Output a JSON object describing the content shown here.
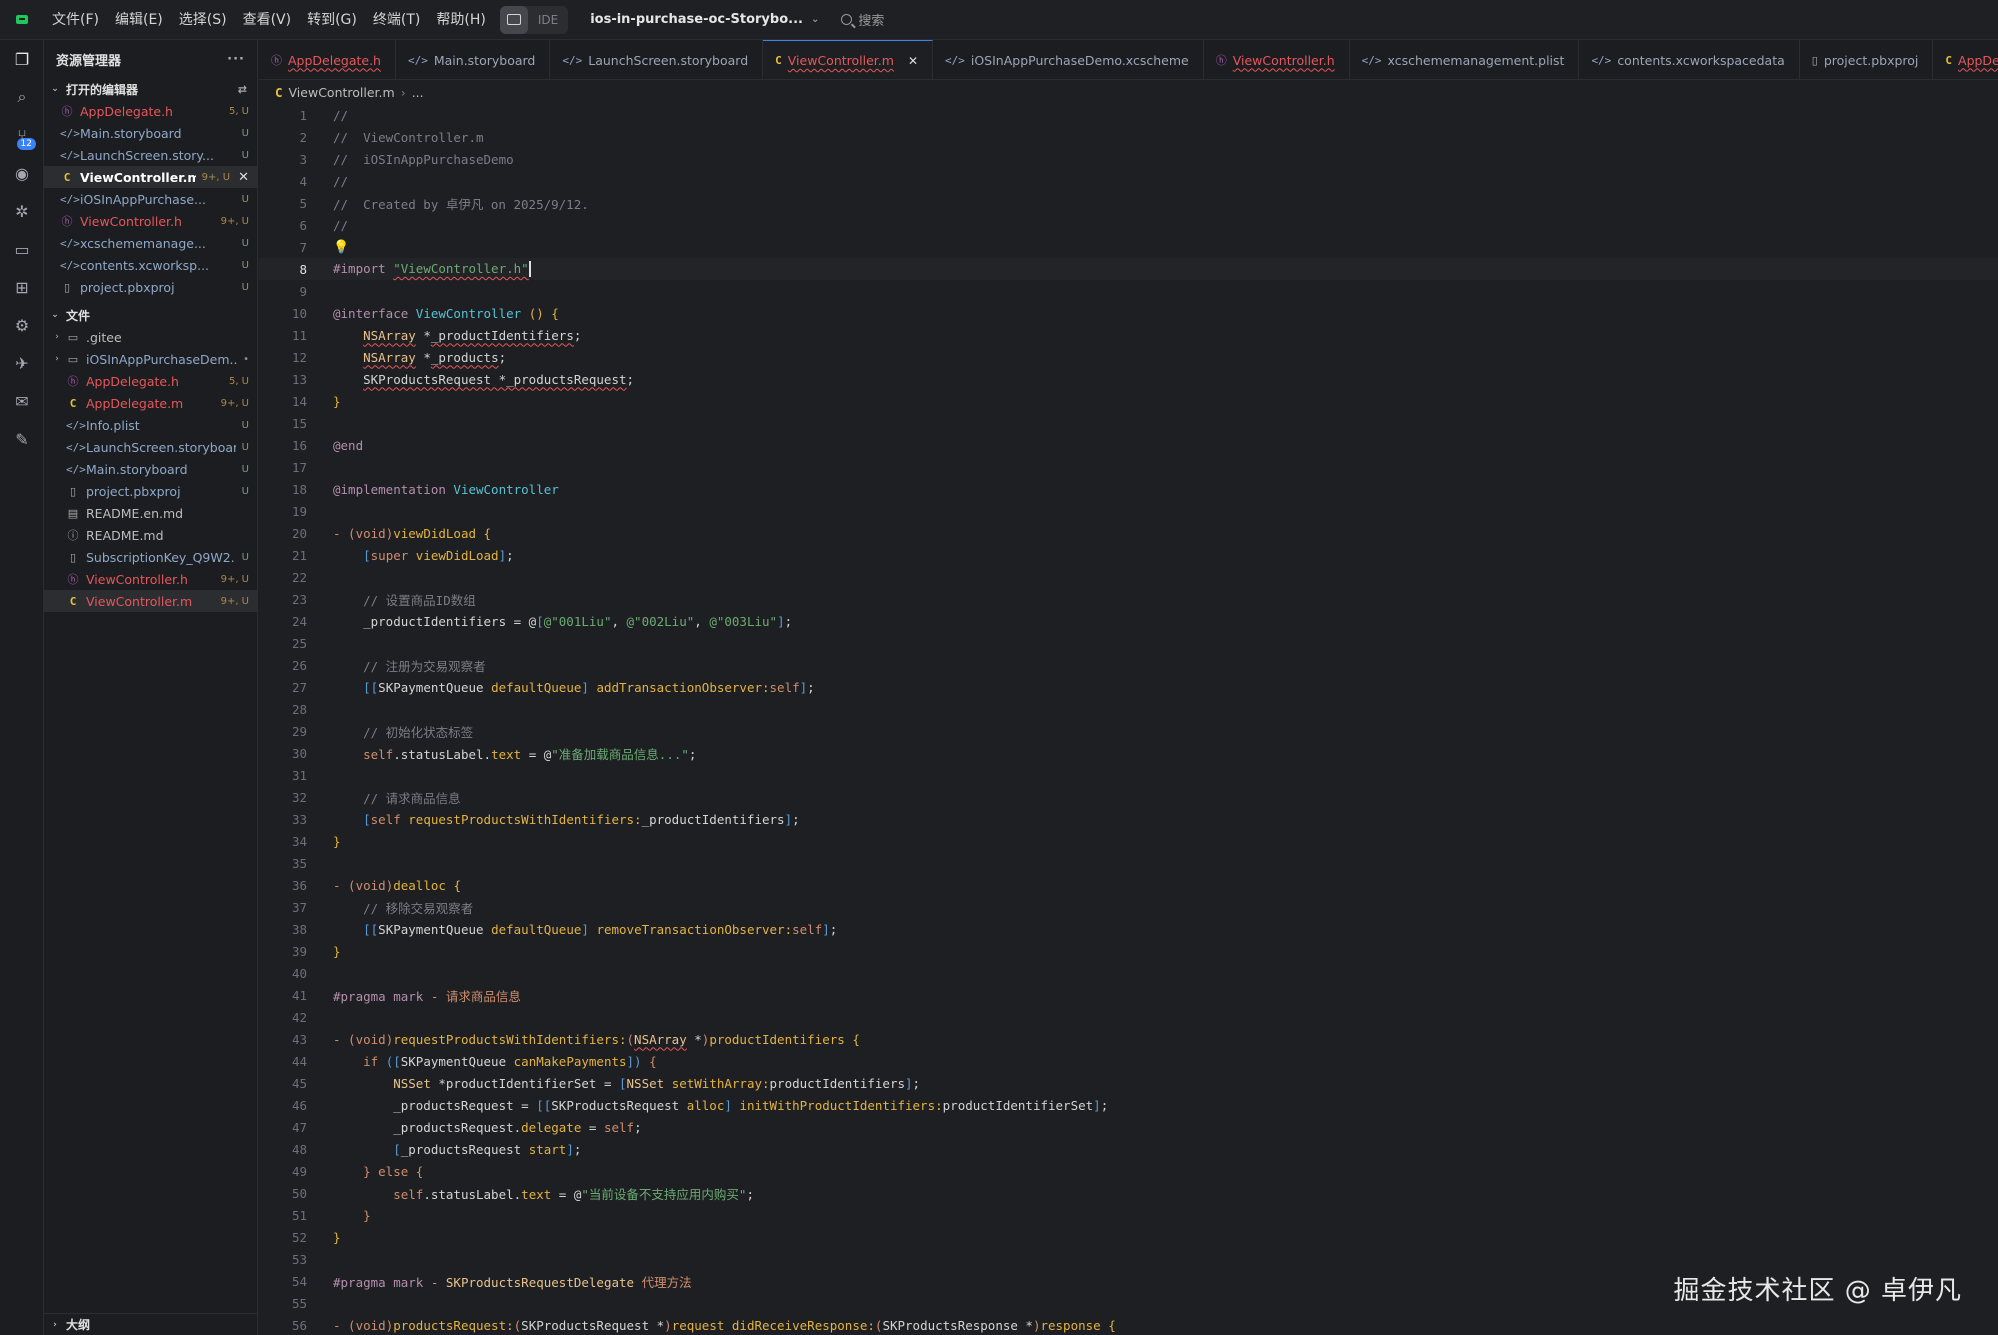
{
  "menu": [
    "文件(F)",
    "编辑(E)",
    "选择(S)",
    "查看(V)",
    "转到(G)",
    "终端(T)",
    "帮助(H)"
  ],
  "ide_label": "IDE",
  "project": "ios-in-purchase-oc-Storybo...",
  "search_label": "搜索",
  "activity_badge": "12",
  "sidebar": {
    "title": "资源管理器",
    "open_editors_label": "打开的编辑器",
    "open_editors": [
      {
        "name": "AppDelegate.h",
        "status": "5, U",
        "icon": "header-icon",
        "style": "err"
      },
      {
        "name": "Main.storyboard",
        "status": "U",
        "icon": "code-icon",
        "style": "mod"
      },
      {
        "name": "LaunchScreen.story...",
        "status": "U",
        "icon": "code-icon",
        "style": "mod"
      },
      {
        "name": "ViewController.m",
        "status": "9+, U",
        "icon": "c-file-icon",
        "style": "bold"
      },
      {
        "name": "iOSInAppPurchase...",
        "status": "U",
        "icon": "code-icon",
        "style": "mod"
      },
      {
        "name": "ViewController.h",
        "status": "9+, U",
        "icon": "header-icon",
        "style": "err"
      },
      {
        "name": "xcschememanage...",
        "status": "U",
        "icon": "code-icon",
        "style": "mod"
      },
      {
        "name": "contents.xcworksp...",
        "status": "U",
        "icon": "code-icon",
        "style": "mod"
      },
      {
        "name": "project.pbxproj",
        "status": "U",
        "icon": "file-icon",
        "style": "mod"
      }
    ],
    "files_label": "文件",
    "files": [
      {
        "name": ".gitee",
        "status": "",
        "icon": "folder-icon",
        "style": "plain",
        "caret": "›"
      },
      {
        "name": "iOSInAppPurchaseDem...",
        "status": "•",
        "icon": "folder-icon",
        "style": "mod",
        "caret": "›"
      },
      {
        "name": "AppDelegate.h",
        "status": "5, U",
        "icon": "header-icon",
        "style": "err",
        "caret": ""
      },
      {
        "name": "AppDelegate.m",
        "status": "9+, U",
        "icon": "c-file-icon",
        "style": "err",
        "caret": ""
      },
      {
        "name": "Info.plist",
        "status": "U",
        "icon": "code-icon",
        "style": "mod",
        "caret": ""
      },
      {
        "name": "LaunchScreen.storyboard",
        "status": "U",
        "icon": "code-icon",
        "style": "mod",
        "caret": ""
      },
      {
        "name": "Main.storyboard",
        "status": "U",
        "icon": "code-icon",
        "style": "mod",
        "caret": ""
      },
      {
        "name": "project.pbxproj",
        "status": "U",
        "icon": "file-icon",
        "style": "mod",
        "caret": ""
      },
      {
        "name": "README.en.md",
        "status": "",
        "icon": "markdown-icon",
        "style": "plain",
        "caret": ""
      },
      {
        "name": "README.md",
        "status": "",
        "icon": "info-icon",
        "style": "plain",
        "caret": ""
      },
      {
        "name": "SubscriptionKey_Q9W2...",
        "status": "U",
        "icon": "file-icon",
        "style": "mod",
        "caret": ""
      },
      {
        "name": "ViewController.h",
        "status": "9+, U",
        "icon": "header-icon",
        "style": "err",
        "caret": ""
      },
      {
        "name": "ViewController.m",
        "status": "9+, U",
        "icon": "c-file-icon",
        "style": "err",
        "caret": ""
      }
    ],
    "outline_label": "大纲"
  },
  "tabs": [
    {
      "name": "AppDelegate.h",
      "icon": "header-icon",
      "style": "err"
    },
    {
      "name": "Main.storyboard",
      "icon": "code-icon",
      "style": "mod"
    },
    {
      "name": "LaunchScreen.storyboard",
      "icon": "code-icon",
      "style": "mod"
    },
    {
      "name": "ViewController.m",
      "icon": "c-file-icon",
      "style": "err",
      "active": true
    },
    {
      "name": "iOSInAppPurchaseDemo.xcscheme",
      "icon": "code-icon",
      "style": "mod"
    },
    {
      "name": "ViewController.h",
      "icon": "header-icon",
      "style": "err"
    },
    {
      "name": "xcschememanagement.plist",
      "icon": "code-icon",
      "style": "mod"
    },
    {
      "name": "contents.xcworkspacedata",
      "icon": "code-icon",
      "style": "mod"
    },
    {
      "name": "project.pbxproj",
      "icon": "file-icon",
      "style": "mod"
    },
    {
      "name": "AppDelegate.m",
      "icon": "c-file-icon",
      "style": "err"
    }
  ],
  "breadcrumb": {
    "file": "ViewController.m",
    "rest": "..."
  },
  "editor": {
    "current_line": 8,
    "lines": [
      [
        [
          "cm",
          "//"
        ]
      ],
      [
        [
          "cm",
          "//  ViewController.m"
        ]
      ],
      [
        [
          "cm",
          "//  iOSInAppPurchaseDemo"
        ]
      ],
      [
        [
          "cm",
          "//"
        ]
      ],
      [
        [
          "cm",
          "//  Created by 卓伊凡 on 2025/9/12."
        ]
      ],
      [
        [
          "cm",
          "//"
        ]
      ],
      [
        [
          "bulb",
          "💡"
        ]
      ],
      [
        [
          "pp",
          "#import "
        ],
        [
          "st_wv",
          "\"ViewController.h\""
        ],
        [
          "cursor",
          ""
        ]
      ],
      [],
      [
        [
          "pp",
          "@interface "
        ],
        [
          "cl",
          "ViewController "
        ],
        [
          "fn",
          "() {"
        ]
      ],
      [
        [
          "vr",
          "    "
        ],
        [
          "ty_wv",
          "NSArray"
        ],
        [
          "vr",
          " *"
        ],
        [
          "vr_wv",
          "_productIdentifiers"
        ],
        [
          "vr",
          ";"
        ]
      ],
      [
        [
          "vr",
          "    "
        ],
        [
          "ty_wv",
          "NSArray"
        ],
        [
          "vr",
          " *"
        ],
        [
          "vr_wv",
          "_products"
        ],
        [
          "vr",
          ";"
        ]
      ],
      [
        [
          "vr",
          "    "
        ],
        [
          "vr_wv",
          "SKProductsRequest *_productsRequest"
        ],
        [
          "vr",
          ";"
        ]
      ],
      [
        [
          "fn",
          "}"
        ]
      ],
      [],
      [
        [
          "pp",
          "@end"
        ]
      ],
      [],
      [
        [
          "pp",
          "@implementation "
        ],
        [
          "cl",
          "ViewController"
        ]
      ],
      [],
      [
        [
          "kw",
          "- ("
        ],
        [
          "kw",
          "void"
        ],
        [
          "kw",
          ")"
        ],
        [
          "fn",
          "viewDidLoad "
        ],
        [
          "fn",
          "{"
        ]
      ],
      [
        [
          "vr",
          "    "
        ],
        [
          "br",
          "["
        ],
        [
          "kw",
          "super "
        ],
        [
          "fn",
          "viewDidLoad"
        ],
        [
          "br",
          "]"
        ],
        [
          "vr",
          ";"
        ]
      ],
      [],
      [
        [
          "vr",
          "    "
        ],
        [
          "cm",
          "// 设置商品ID数组"
        ]
      ],
      [
        [
          "vr",
          "    _productIdentifiers = @"
        ],
        [
          "br",
          "["
        ],
        [
          "st",
          "@\"001Liu\""
        ],
        [
          "vr",
          ", "
        ],
        [
          "st",
          "@\"002Liu\""
        ],
        [
          "vr",
          ", "
        ],
        [
          "st",
          "@\"003Liu\""
        ],
        [
          "br",
          "]"
        ],
        [
          "vr",
          ";"
        ]
      ],
      [],
      [
        [
          "vr",
          "    "
        ],
        [
          "cm",
          "// 注册为交易观察者"
        ]
      ],
      [
        [
          "vr",
          "    "
        ],
        [
          "br",
          "[["
        ],
        [
          "vr",
          "SKPaymentQueue "
        ],
        [
          "fn",
          "defaultQueue"
        ],
        [
          "br",
          "] "
        ],
        [
          "fn",
          "addTransactionObserver:"
        ],
        [
          "kw",
          "self"
        ],
        [
          "br",
          "]"
        ],
        [
          "vr",
          ";"
        ]
      ],
      [],
      [
        [
          "vr",
          "    "
        ],
        [
          "cm",
          "// 初始化状态标签"
        ]
      ],
      [
        [
          "vr",
          "    "
        ],
        [
          "kw",
          "self"
        ],
        [
          "vr",
          ".statusLabel."
        ],
        [
          "fn",
          "text"
        ],
        [
          "vr",
          " = @"
        ],
        [
          "st",
          "\"准备加载商品信息...\""
        ],
        [
          "vr",
          ";"
        ]
      ],
      [],
      [
        [
          "vr",
          "    "
        ],
        [
          "cm",
          "// 请求商品信息"
        ]
      ],
      [
        [
          "vr",
          "    "
        ],
        [
          "br",
          "["
        ],
        [
          "kw",
          "self "
        ],
        [
          "fn",
          "requestProductsWithIdentifiers:"
        ],
        [
          "vr",
          "_productIdentifiers"
        ],
        [
          "br",
          "]"
        ],
        [
          "vr",
          ";"
        ]
      ],
      [
        [
          "fn",
          "}"
        ]
      ],
      [],
      [
        [
          "kw",
          "- ("
        ],
        [
          "kw",
          "void"
        ],
        [
          "kw",
          ")"
        ],
        [
          "fn",
          "dealloc "
        ],
        [
          "fn",
          "{"
        ]
      ],
      [
        [
          "vr",
          "    "
        ],
        [
          "cm",
          "// 移除交易观察者"
        ]
      ],
      [
        [
          "vr",
          "    "
        ],
        [
          "br",
          "[["
        ],
        [
          "vr",
          "SKPaymentQueue "
        ],
        [
          "fn",
          "defaultQueue"
        ],
        [
          "br",
          "] "
        ],
        [
          "fn",
          "removeTransactionObserver:"
        ],
        [
          "kw",
          "self"
        ],
        [
          "br",
          "]"
        ],
        [
          "vr",
          ";"
        ]
      ],
      [
        [
          "fn",
          "}"
        ]
      ],
      [],
      [
        [
          "pp",
          "#pragma mark "
        ],
        [
          "kw",
          "- 请求商品信息"
        ]
      ],
      [],
      [
        [
          "kw",
          "- ("
        ],
        [
          "kw",
          "void"
        ],
        [
          "kw",
          ")"
        ],
        [
          "fn",
          "requestProductsWithIdentifiers:"
        ],
        [
          "kw",
          "("
        ],
        [
          "ty_wv",
          "NSArray"
        ],
        [
          "vr",
          " *"
        ],
        [
          "kw",
          ")"
        ],
        [
          "fn",
          "productIdentifiers {"
        ]
      ],
      [
        [
          "vr",
          "    "
        ],
        [
          "kw",
          "if "
        ],
        [
          "br",
          "(["
        ],
        [
          "vr",
          "SKPaymentQueue "
        ],
        [
          "fn",
          "canMakePayments"
        ],
        [
          "br",
          "]) "
        ],
        [
          "kw",
          "{"
        ]
      ],
      [
        [
          "vr",
          "        "
        ],
        [
          "ty",
          "NSSet "
        ],
        [
          "vr",
          "*productIdentifierSet = "
        ],
        [
          "br",
          "["
        ],
        [
          "ty",
          "NSSet "
        ],
        [
          "fn",
          "setWithArray:"
        ],
        [
          "vr",
          "productIdentifiers"
        ],
        [
          "br",
          "]"
        ],
        [
          "vr",
          ";"
        ]
      ],
      [
        [
          "vr",
          "        _productsRequest = "
        ],
        [
          "br",
          "[["
        ],
        [
          "vr",
          "SKProductsRequest "
        ],
        [
          "fn",
          "alloc"
        ],
        [
          "br",
          "] "
        ],
        [
          "fn",
          "initWithProductIdentifiers:"
        ],
        [
          "vr",
          "productIdentifierSet"
        ],
        [
          "br",
          "]"
        ],
        [
          "vr",
          ";"
        ]
      ],
      [
        [
          "vr",
          "        _productsRequest."
        ],
        [
          "fn",
          "delegate"
        ],
        [
          "vr",
          " = "
        ],
        [
          "kw",
          "self"
        ],
        [
          "vr",
          ";"
        ]
      ],
      [
        [
          "vr",
          "        "
        ],
        [
          "br",
          "["
        ],
        [
          "vr",
          "_productsRequest "
        ],
        [
          "fn",
          "start"
        ],
        [
          "br",
          "]"
        ],
        [
          "vr",
          ";"
        ]
      ],
      [
        [
          "vr",
          "    "
        ],
        [
          "kw",
          "} else {"
        ]
      ],
      [
        [
          "vr",
          "        "
        ],
        [
          "kw",
          "self"
        ],
        [
          "vr",
          ".statusLabel."
        ],
        [
          "fn",
          "text"
        ],
        [
          "vr",
          " = @"
        ],
        [
          "st",
          "\"当前设备不支持应用内购买\""
        ],
        [
          "vr",
          ";"
        ]
      ],
      [
        [
          "vr",
          "    "
        ],
        [
          "kw",
          "}"
        ]
      ],
      [
        [
          "fn",
          "}"
        ]
      ],
      [],
      [
        [
          "pp",
          "#pragma mark "
        ],
        [
          "kw",
          "- "
        ],
        [
          "ty",
          "SKProductsRequestDelegate "
        ],
        [
          "kw",
          "代理方法"
        ]
      ],
      [],
      [
        [
          "kw",
          "- ("
        ],
        [
          "kw",
          "void"
        ],
        [
          "kw",
          ")"
        ],
        [
          "fn",
          "productsRequest:"
        ],
        [
          "kw",
          "("
        ],
        [
          "vr",
          "SKProductsRequest *"
        ],
        [
          "kw",
          ")"
        ],
        [
          "fn",
          "request didReceiveResponse:"
        ],
        [
          "kw",
          "("
        ],
        [
          "vr",
          "SKProductsResponse *"
        ],
        [
          "kw",
          ")"
        ],
        [
          "fn",
          "response {"
        ]
      ]
    ]
  },
  "watermark": "掘金技术社区 @ 卓伊凡",
  "colors": {
    "accent": "#3b82f6",
    "error": "#e5575b",
    "bg": "#1e1f22"
  }
}
